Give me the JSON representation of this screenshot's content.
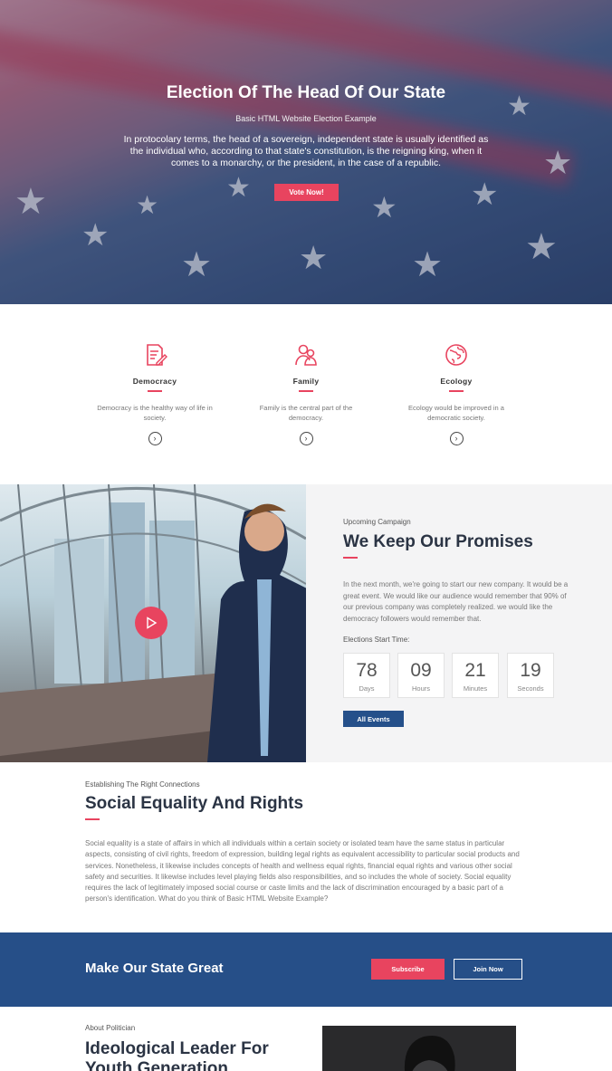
{
  "hero": {
    "title": "Election Of The Head Of Our State",
    "subtitle": "Basic HTML Website Election Example",
    "text": "In protocolary terms, the head of a sovereign, independent state is usually identified as the individual who, according to that state's constitution, is the reigning king, when it comes to a monarchy, or the president, in the case of a republic.",
    "button": "Vote Now!"
  },
  "features": [
    {
      "title": "Democracy",
      "text": "Democracy is the healthy way of life in society.",
      "icon": "document-edit-icon"
    },
    {
      "title": "Family",
      "text": "Family is the central part of the democracy.",
      "icon": "family-icon"
    },
    {
      "title": "Ecology",
      "text": "Ecology would be improved in a democratic society.",
      "icon": "globe-icon"
    }
  ],
  "promises": {
    "eyebrow": "Upcoming Campaign",
    "title": "We Keep Our Promises",
    "text": "In the next month, we're going to start our new company. It would be a great event. We would like our audience would remember that 90% of our previous company was completely realized. we would like the democracy followers would remember that.",
    "start_label": "Elections Start Time:",
    "countdown": [
      {
        "value": "78",
        "label": "Days"
      },
      {
        "value": "09",
        "label": "Hours"
      },
      {
        "value": "21",
        "label": "Minutes"
      },
      {
        "value": "19",
        "label": "Seconds"
      }
    ],
    "button": "All Events"
  },
  "social": {
    "eyebrow": "Establishing The Right Connections",
    "title": "Social Equality And Rights",
    "text": "Social equality is a state of affairs in which all individuals within a certain society or isolated team have the same status in particular aspects, consisting of civil rights, freedom of expression, building legal rights as equivalent accessibility to particular social products and services. Nonetheless, it likewise includes concepts of health and wellness equal rights, financial equal rights and various other social safety and securities. It likewise includes level playing fields also responsibilities, and so includes the whole of society. Social equality requires the lack of legitimately imposed social course or caste limits and the lack of discrimination encouraged by a basic part of a person's identification. What do you think of Basic HTML Website Example?"
  },
  "cta": {
    "title": "Make Our State Great",
    "subscribe": "Subscribe",
    "join": "Join Now"
  },
  "about": {
    "eyebrow": "About Politician",
    "title": "Ideological Leader For Youth Generation"
  },
  "colors": {
    "accent": "#e8445f",
    "brand": "#264f88",
    "heading": "#2b3444"
  }
}
